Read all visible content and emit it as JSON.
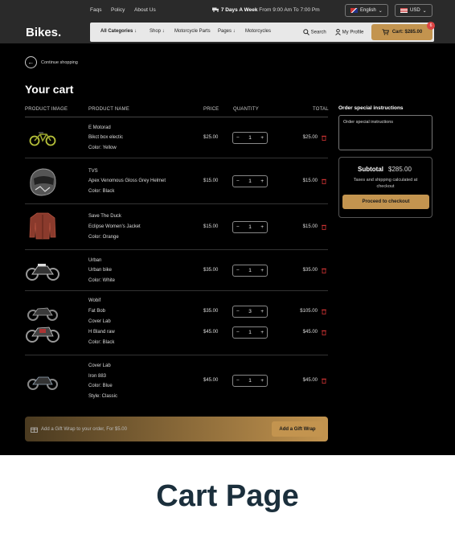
{
  "topbar": {
    "links": [
      "Faqs",
      "Policy",
      "About Us"
    ],
    "promo_bold": "7 Days A Week",
    "promo_rest": "From 9:00 Am To 7:00 Pm",
    "language": "English",
    "currency": "USD"
  },
  "header": {
    "logo": "Bikes.",
    "categories": "All Categories",
    "nav": [
      "Shop",
      "Motorcycle Parts",
      "Pages",
      "Motorcycles"
    ],
    "search": "Search",
    "profile": "My Profile",
    "cart_label": "Cart: $285.00",
    "cart_count": "6"
  },
  "page": {
    "back": "Continue shopping",
    "title": "Your cart",
    "columns": [
      "PRODUCT IMAGE",
      "PRODUCT NAME",
      "PRICE",
      "QUANTITY",
      "TOTAL"
    ]
  },
  "items": [
    {
      "lines": [
        "E Motorad",
        "Bikct box electic",
        "Color: Yellow"
      ],
      "price": "$25.00",
      "qty": "1",
      "total": "$25.00"
    },
    {
      "lines": [
        "TVS",
        "Apex Venomous Gloss Grey Helmet",
        "Color: Black"
      ],
      "price": "$15.00",
      "qty": "1",
      "total": "$15.00"
    },
    {
      "lines": [
        "Save The Duck",
        "Eclipse Women's Jacket",
        "Color: Orange"
      ],
      "price": "$15.00",
      "qty": "1",
      "total": "$15.00"
    },
    {
      "lines": [
        "Urban",
        "Urban bike",
        "Color: White"
      ],
      "price": "$35.00",
      "qty": "1",
      "total": "$35.00"
    },
    {
      "lines": [
        "Wobif",
        "Fat Bob",
        "Cover Lab",
        "H Bland raw",
        "Color: Black"
      ],
      "price": "$35.00",
      "qty": "3",
      "total": "$105.00",
      "price2": "$45.00",
      "qty2": "1",
      "total2": "$45.00"
    },
    {
      "lines": [
        "Cover Lab",
        "Iron 883",
        "Color: Blue",
        "Style: Classic"
      ],
      "price": "$45.00",
      "qty": "1",
      "total": "$45.00"
    }
  ],
  "gift": {
    "text": "Add a Gift Wrap to your order, For $5.00",
    "button": "Add a Gift Wrap"
  },
  "sidebar": {
    "instructions_label": "Order special instructions",
    "instructions_placeholder": "Order special instructions",
    "subtotal_label": "Subtotal",
    "subtotal_value": "$285.00",
    "tax_note_1": "Taxes and shipping calculated at",
    "tax_note_2": "checkout",
    "checkout": "Proceed to checkout"
  },
  "caption": "Cart Page",
  "colors": {
    "accent": "#c3944f",
    "background": "#000000",
    "caption": "#1b2f3c"
  },
  "icons": [
    "truck-icon",
    "chevron-down-icon",
    "search-icon",
    "user-icon",
    "cart-icon",
    "back-arrow-icon",
    "trash-icon",
    "gift-icon",
    "minus-icon",
    "plus-icon"
  ]
}
